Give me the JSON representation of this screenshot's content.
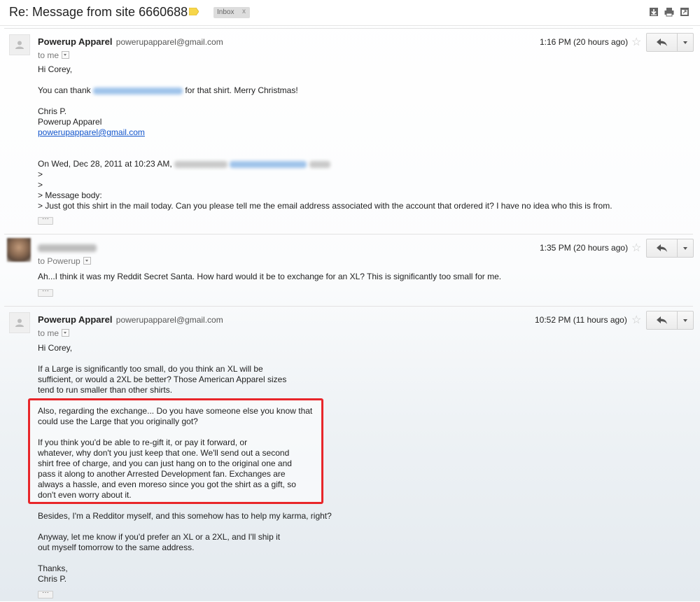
{
  "subject": {
    "title": "Re: Message from site 6660688",
    "label_chip": "Inbox",
    "label_remove": "x",
    "label_color": "#f7d64a",
    "actions": [
      "download-icon",
      "print-icon",
      "new-window-icon"
    ]
  },
  "messages": [
    {
      "sender_name": "Powerup Apparel",
      "sender_email": "powerupapparel@gmail.com",
      "to": "to me",
      "time": "1:16 PM (20 hours ago)",
      "body": {
        "greeting": "Hi Corey,",
        "thank_prefix": "You can thank",
        "thank_suffix": "for that shirt. Merry Christmas!",
        "sig_name": "Chris P.",
        "sig_company": "Powerup Apparel",
        "sig_email": "powerupapparel@gmail.com",
        "quote_header": "On Wed, Dec 28, 2011 at 10:23 AM,",
        "quote_line1": ">",
        "quote_line2": ">",
        "quote_line3": "> Message body:",
        "quote_line4": "> Just got this shirt in the mail today.  Can you please tell me the email address associated with the account that ordered it?  I have no idea who this is from."
      },
      "ellipsis": "···"
    },
    {
      "to": "to Powerup",
      "time": "1:35 PM (20 hours ago)",
      "body": {
        "line1": "Ah...I think it was my Reddit Secret Santa.  How hard would it be to exchange for an XL?  This is significantly too small for me."
      },
      "ellipsis": "···"
    },
    {
      "sender_name": "Powerup Apparel",
      "sender_email": "powerupapparel@gmail.com",
      "to": "to me",
      "time": "10:52 PM (11 hours ago)",
      "body": {
        "greeting": "Hi Corey,",
        "p1_l1": "If a Large is significantly too small, do you think an XL will be",
        "p1_l2": "sufficient, or would a 2XL be better? Those American Apparel sizes",
        "p1_l3": "tend to run smaller than other shirts.",
        "p2_l1": "Also, regarding the exchange... Do you have someone else you know that",
        "p2_l2": "could use the Large that you originally got?",
        "p3_l1": "If you think you'd be able to re-gift it, or pay it forward, or",
        "p3_l2": "whatever, why don't you just keep that one. We'll send out a second",
        "p3_l3": "shirt free of charge, and you can just hang on to the original one and",
        "p3_l4": "pass it along to another Arrested Development fan. Exchanges are",
        "p3_l5": "always a hassle, and even moreso since you got the shirt as a gift, so",
        "p3_l6": "don't even worry about it.",
        "p4": "Besides, I'm a Redditor myself, and this somehow has to help my karma, right?",
        "p5_l1": "Anyway, let me know if you'd prefer an XL or a 2XL, and I'll ship it",
        "p5_l2": "out myself tomorrow to the same address.",
        "sign_off": "Thanks,",
        "sign_name": "Chris P."
      },
      "ellipsis": "···"
    }
  ],
  "annotation_color": "#e8262a",
  "star_glyph": "☆"
}
